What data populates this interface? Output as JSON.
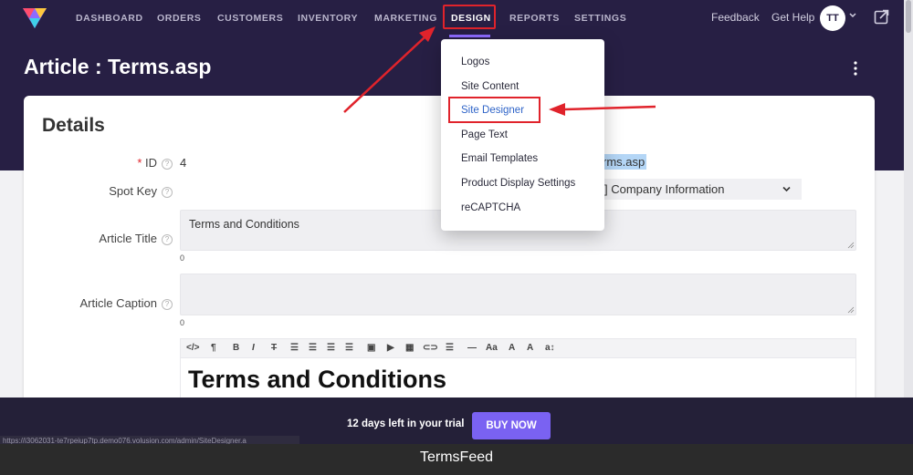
{
  "nav": {
    "items": [
      "DASHBOARD",
      "ORDERS",
      "CUSTOMERS",
      "INVENTORY",
      "MARKETING",
      "DESIGN",
      "REPORTS",
      "SETTINGS"
    ],
    "active": "DESIGN",
    "feedback": "Feedback",
    "get_help": "Get Help",
    "avatar_initials": "TT"
  },
  "page": {
    "title": "Article : Terms.asp"
  },
  "details": {
    "heading": "Details",
    "id_label": "ID",
    "id_value": "4",
    "filename_fragment": "rms.asp",
    "spot_key_label": "Spot Key",
    "spot_key_value": "] Company Information",
    "article_title_label": "Article Title",
    "article_title_value": "Terms and Conditions",
    "article_title_count": "0",
    "article_caption_label": "Article Caption",
    "article_caption_value": "",
    "article_caption_count": "0",
    "editor_heading": "Terms and Conditions"
  },
  "editor_toolbar": [
    "</>",
    "¶",
    "B",
    "I",
    "T",
    "☰",
    "☰",
    "☰",
    "☰",
    "▣",
    "▶",
    "▦",
    "⊂⊃",
    "☰",
    "—",
    "Aa",
    "A",
    "A",
    "a↕"
  ],
  "dropdown": {
    "items": [
      "Logos",
      "Site Content",
      "Site Designer",
      "Page Text",
      "Email Templates",
      "Product Display Settings",
      "reCAPTCHA"
    ],
    "highlighted": "Site Designer"
  },
  "trial": {
    "text": "12 days left in your trial",
    "button": "BUY NOW"
  },
  "status_url": "https://i3062031-te7rpeiup7tp.demo076.volusion.com/admin/SiteDesigner.a",
  "caption": "TermsFeed",
  "colors": {
    "header_bg": "#271f44",
    "accent": "#7a62f2",
    "annotation_red": "#e0232b",
    "link_blue": "#2f64c8"
  }
}
